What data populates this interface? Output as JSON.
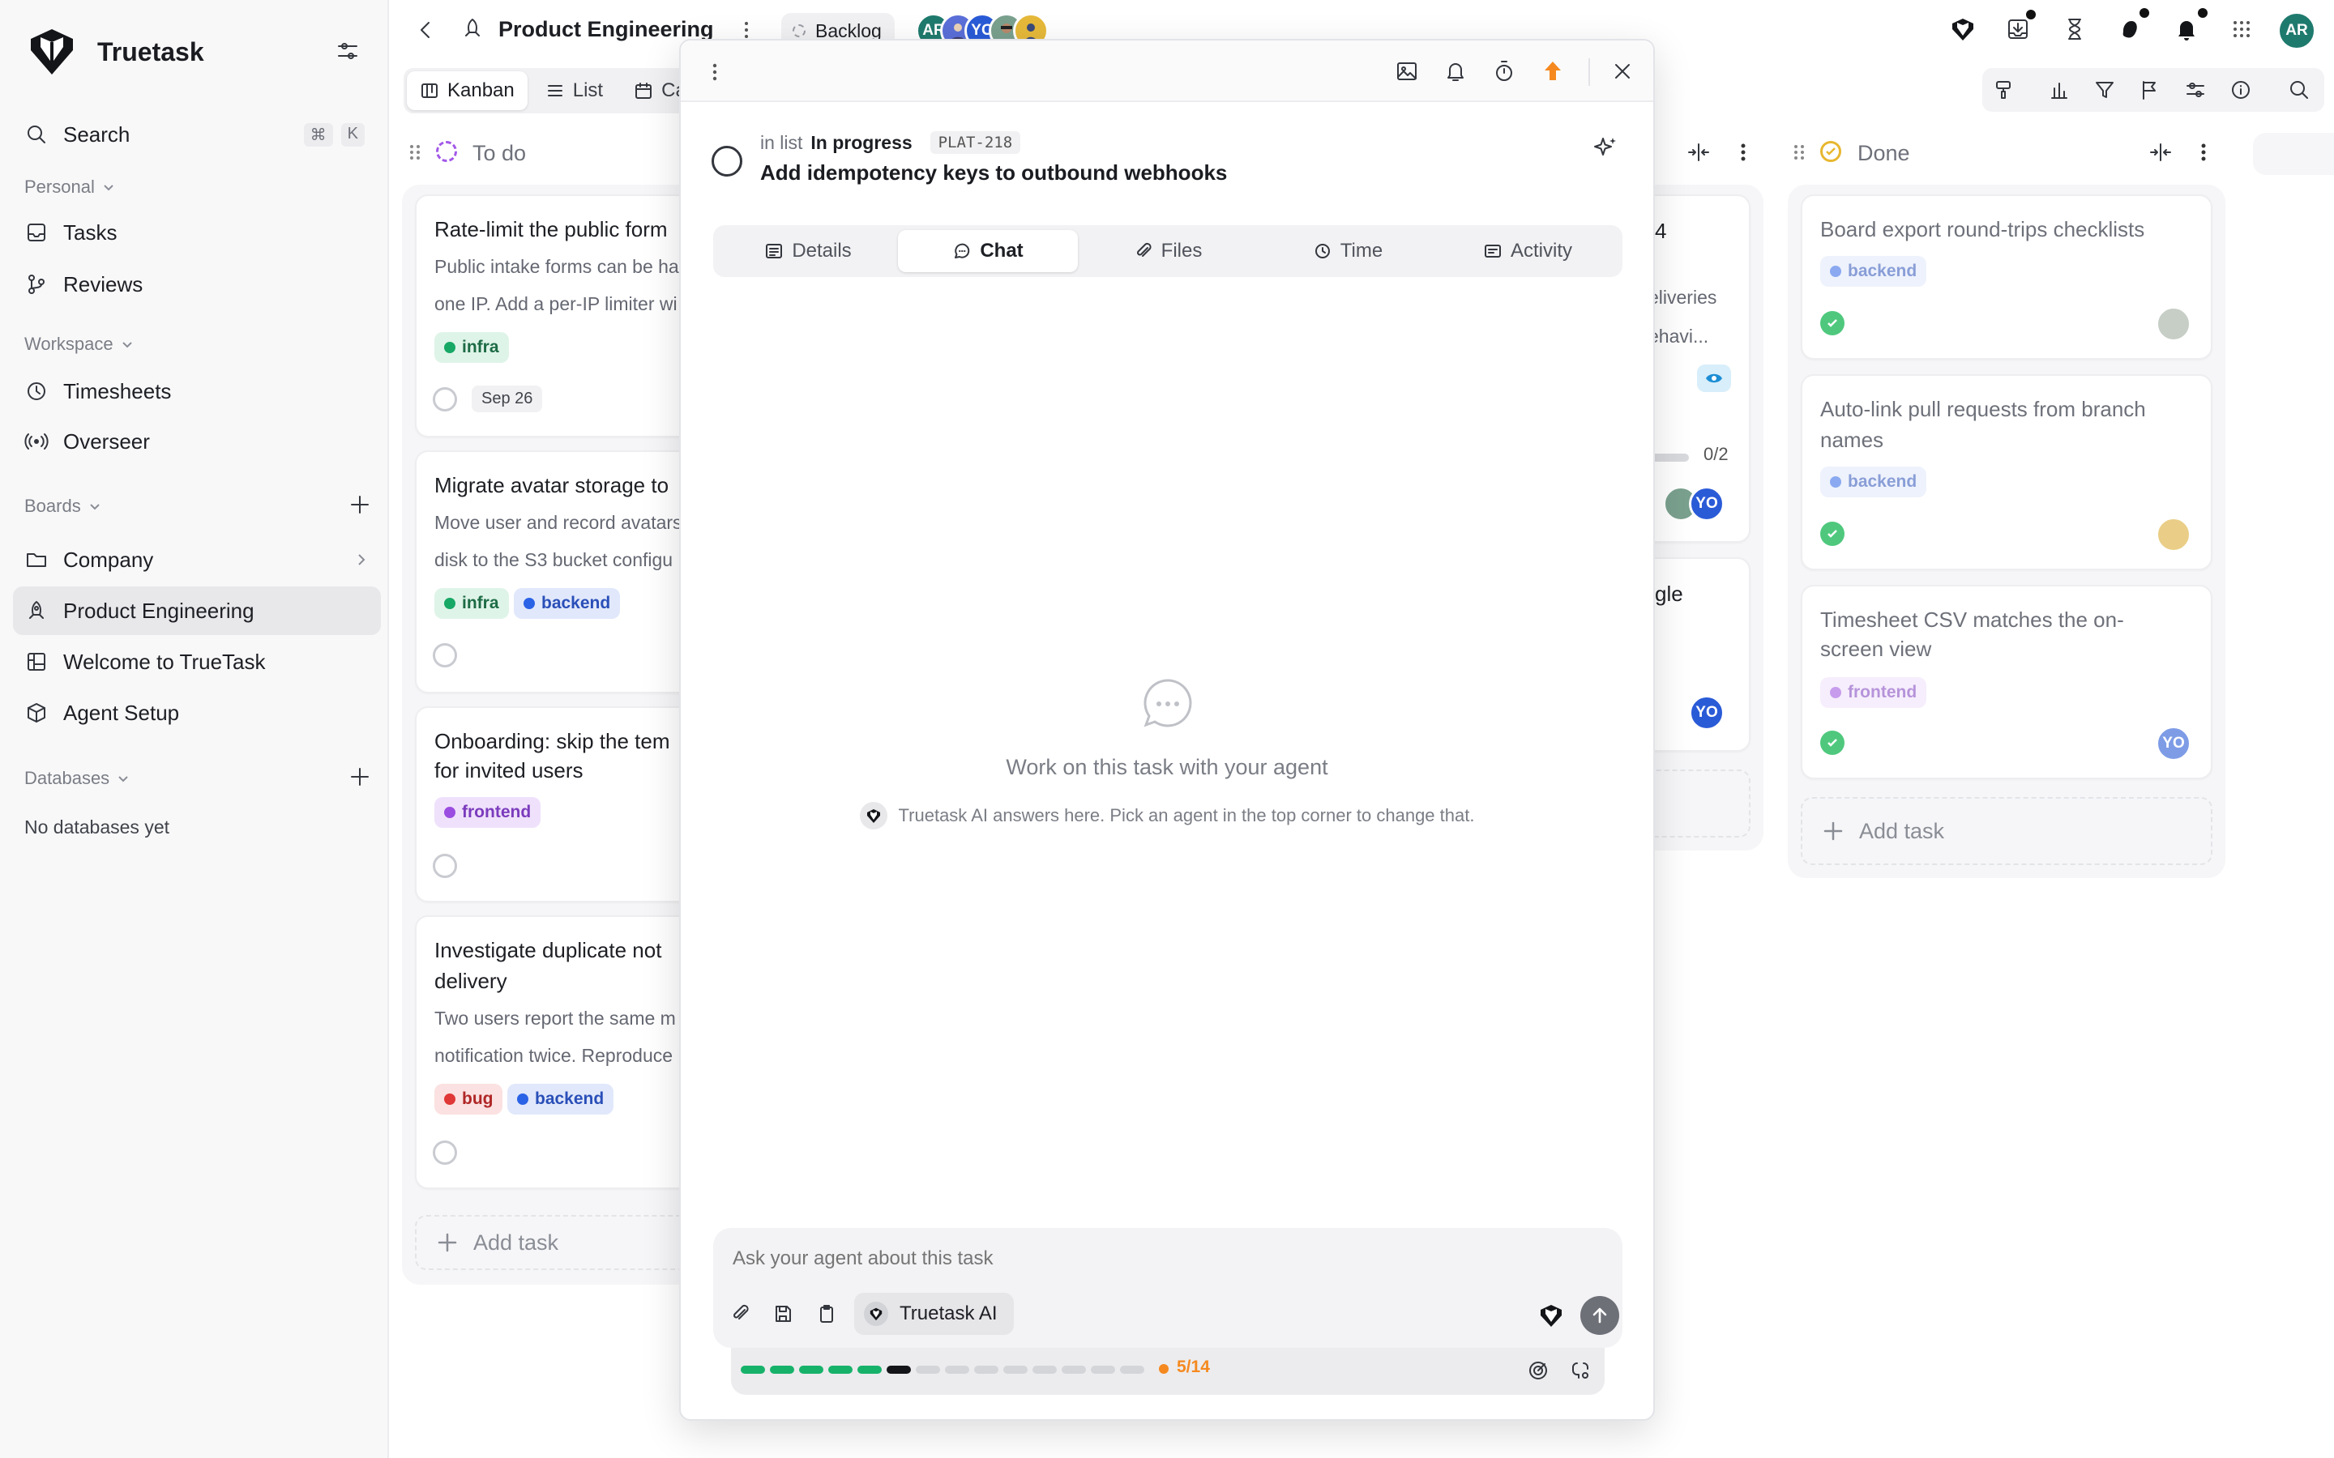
{
  "app": {
    "name": "Truetask"
  },
  "sidebar": {
    "search_label": "Search",
    "search_kbd_1": "⌘",
    "search_kbd_2": "K",
    "personal_label": "Personal",
    "personal_items": [
      {
        "label": "Tasks",
        "icon": "inbox-icon"
      },
      {
        "label": "Reviews",
        "icon": "git-branch-icon"
      }
    ],
    "workspace_label": "Workspace",
    "workspace_items": [
      {
        "label": "Timesheets",
        "icon": "clock-icon"
      },
      {
        "label": "Overseer",
        "icon": "broadcast-icon"
      }
    ],
    "boards_label": "Boards",
    "boards_items": [
      {
        "label": "Company",
        "icon": "folder-icon"
      },
      {
        "label": "Product Engineering",
        "icon": "rocket-icon",
        "active": true
      },
      {
        "label": "Welcome to TrueTask",
        "icon": "board-icon"
      },
      {
        "label": "Agent Setup",
        "icon": "cube-icon"
      }
    ],
    "databases_label": "Databases",
    "databases_empty": "No databases yet"
  },
  "header": {
    "board_title": "Product Engineering",
    "status_chip": "Backlog",
    "avatar_initials": [
      "AR",
      "YO"
    ],
    "user_initials": "AR"
  },
  "view_tabs": [
    {
      "label": "Kanban",
      "active": true
    },
    {
      "label": "List"
    },
    {
      "label": "Ca"
    }
  ],
  "columns": {
    "todo": {
      "title": "To do",
      "cards": [
        {
          "title": "Rate-limit the public form",
          "desc_1": "Public intake forms can be ha",
          "desc_2": "one IP. Add a per-IP limiter wi",
          "tags": [
            "infra"
          ],
          "date": "Sep 26"
        },
        {
          "title": "Migrate avatar storage to",
          "desc_1": "Move user and record avatars",
          "desc_2": "disk to the S3 bucket configu",
          "tags": [
            "infra",
            "backend"
          ]
        },
        {
          "title_1": "Onboarding: skip the tem",
          "title_2": "for invited users",
          "tags": [
            "frontend"
          ]
        },
        {
          "title_1": "Investigate duplicate not",
          "title_2": "delivery",
          "desc_1": "Two users report the same m",
          "desc_2": "notification twice. Reproduce",
          "tags": [
            "bug",
            "backend"
          ]
        }
      ],
      "add_task": "Add task"
    },
    "in_progress": {
      "card1_title_frag": "4",
      "card1_desc_1": "eliveries",
      "card1_desc_2": "ehavi...",
      "card1_progress": "0/2",
      "card1_progress_fraction": 0,
      "card2_title_frag": "gle"
    },
    "done": {
      "title": "Done",
      "cards": [
        {
          "title_1": "Board export round-trips checklists",
          "tag": "backend"
        },
        {
          "title_1": "Auto-link pull requests from branch",
          "title_2": "names",
          "tag": "backend"
        },
        {
          "title_1": "Timesheet CSV matches the on-",
          "title_2": "screen view",
          "tag": "frontend"
        }
      ],
      "add_task": "Add task"
    }
  },
  "tag_labels": {
    "infra": "infra",
    "backend": "backend",
    "frontend": "frontend",
    "bug": "bug"
  },
  "modal": {
    "list_prefix": "in list",
    "list_name": "In progress",
    "task_id": "PLAT-218",
    "task_title": "Add idempotency keys to outbound webhooks",
    "tabs": [
      {
        "label": "Details",
        "icon": "details-icon"
      },
      {
        "label": "Chat",
        "icon": "chat-icon",
        "active": true
      },
      {
        "label": "Files",
        "icon": "paperclip-icon"
      },
      {
        "label": "Time",
        "icon": "clock-icon"
      },
      {
        "label": "Activity",
        "icon": "activity-icon"
      }
    ],
    "empty_title": "Work on this task with your agent",
    "empty_subtitle": "Truetask AI answers here. Pick an agent in the top corner to change that.",
    "composer_placeholder": "Ask your agent about this task",
    "agent_name": "Truetask AI",
    "progress_label": "5/14",
    "progress_done": 5,
    "progress_total": 14
  },
  "colors": {
    "accent_green": "#17b26a",
    "priority_orange": "#f5891f",
    "avatar_teal": "#1f7a6e",
    "avatar_blue": "#2a5bd7"
  }
}
